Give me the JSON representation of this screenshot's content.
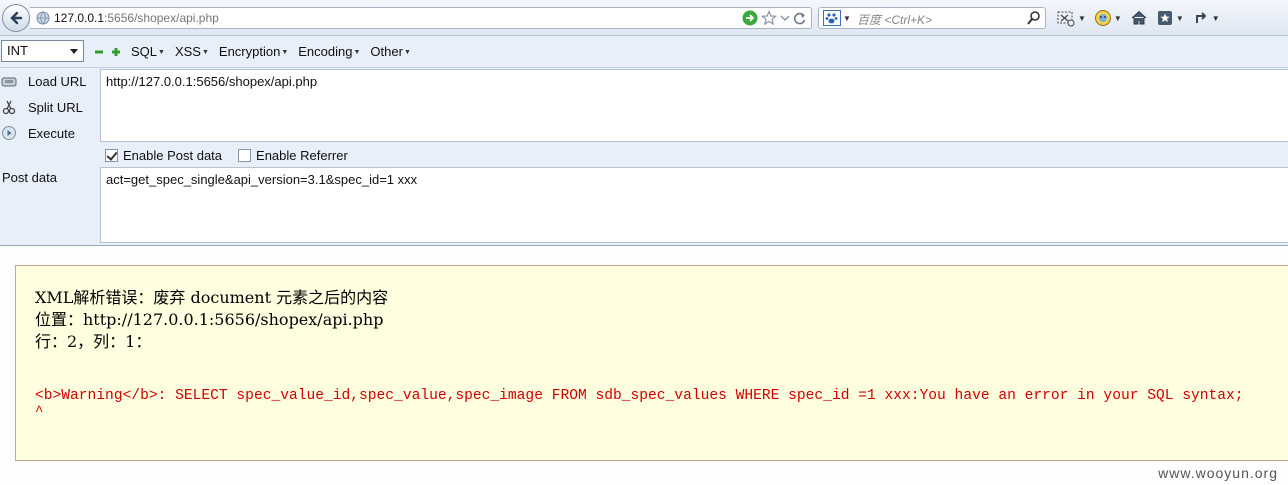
{
  "navbar": {
    "url_host": "127.0.0.1",
    "url_rest": ":5656/shopex/api.php",
    "search_placeholder": "百度 <Ctrl+K>"
  },
  "hackbar": {
    "select_value": "INT",
    "menus": [
      "SQL",
      "XSS",
      "Encryption",
      "Encoding",
      "Other"
    ],
    "buttons": {
      "load_url": "Load URL",
      "split_url": "Split URL",
      "execute": "Execute"
    },
    "url_value": "http://127.0.0.1:5656/shopex/api.php",
    "enable_post_label": "Enable Post data",
    "enable_post_checked": true,
    "enable_referrer_label": "Enable Referrer",
    "enable_referrer_checked": false,
    "post_label": "Post data",
    "post_value": "act=get_spec_single&api_version=3.1&spec_id=1 xxx"
  },
  "error": {
    "line1": "XML解析错误：废弃 document 元素之后的内容",
    "line2": "位置：http://127.0.0.1:5656/shopex/api.php",
    "line3": "行：2，列：1：",
    "warning": "<b>Warning</b>:  SELECT spec_value_id,spec_value,spec_image FROM sdb_spec_values WHERE spec_id =1 xxx:You have an error in your SQL syntax;",
    "caret": "^"
  },
  "watermark": "www.wooyun.org",
  "colors": {
    "error_text": "#d20000",
    "panel_bg": "#ffffe0",
    "toolbar_bg": "#e8eff8"
  }
}
